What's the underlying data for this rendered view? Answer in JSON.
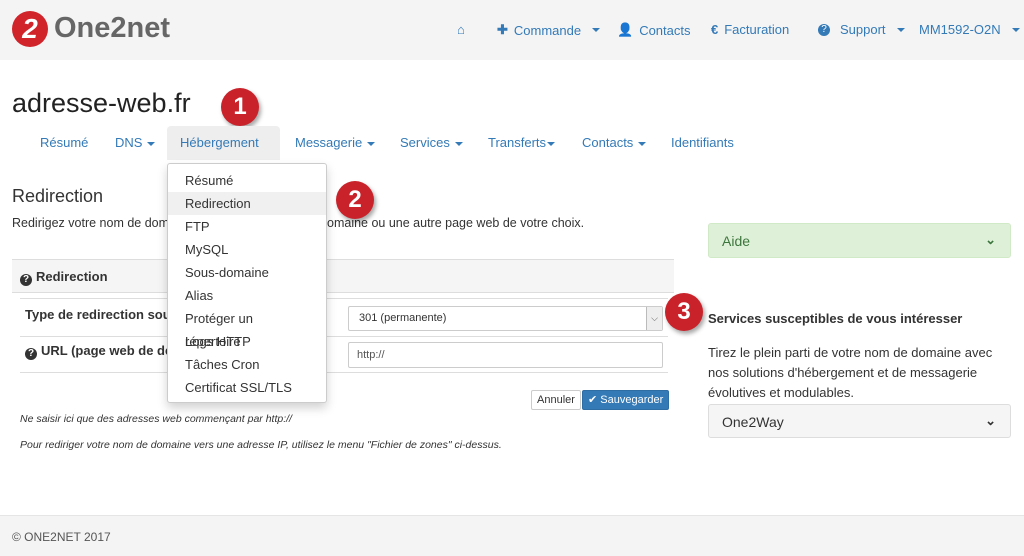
{
  "brand": {
    "logo_mark": "2",
    "name": "One2net"
  },
  "topnav": [
    {
      "icon": "home-icon",
      "label": ""
    },
    {
      "icon": "plus-icon",
      "label": "Commande",
      "caret": true
    },
    {
      "icon": "user-icon",
      "label": "Contacts"
    },
    {
      "icon": "euro-icon",
      "label": "Facturation"
    },
    {
      "icon": "question-icon",
      "label": "Support",
      "caret": true
    },
    {
      "icon": "",
      "label": "MM1592-O2N",
      "caret": true
    }
  ],
  "page_title": "adresse-web.fr",
  "badges": [
    "1",
    "2",
    "3"
  ],
  "tabs": [
    "Résumé",
    "DNS",
    "Hébergement",
    "Messagerie",
    "Services",
    "Transferts",
    "Contacts",
    "Identifiants"
  ],
  "hosting_menu": [
    "Résumé",
    "Redirection",
    "FTP",
    "MySQL",
    "Sous-domaine",
    "Alias",
    "Protéger un répertoire",
    "Logs HTTP",
    "Tâches Cron",
    "Certificat SSL/TLS"
  ],
  "section": {
    "title": "Redirection",
    "desc_left": "Redirigez votre nom de dom",
    "desc_right": "omaine ou une autre page web de votre choix.",
    "panel_title": "Redirection",
    "type_label": "Type de redirection sou",
    "url_label": "URL (page web de de",
    "type_value": "301 (permanente)",
    "url_value": "http://",
    "cancel": "Annuler",
    "save": "Sauvegarder",
    "note1": "Ne saisir ici que des adresses web commençant par http://",
    "note2": "Pour rediriger votre nom de domaine vers une adresse IP, utilisez le menu \"Fichier de zones\" ci-dessus."
  },
  "sidebar": {
    "aide": "Aide",
    "services_title": "Services susceptibles de vous intéresser",
    "services_text": "Tirez le plein parti de votre nom de domaine avec nos solutions d'hébergement et de messagerie évolutives et modulables.",
    "one2way": "One2Way"
  },
  "footer": "© ONE2NET 2017",
  "colors": {
    "brand_red": "#d0232a",
    "link": "#337ab7",
    "help_bg": "#dff0d8"
  }
}
